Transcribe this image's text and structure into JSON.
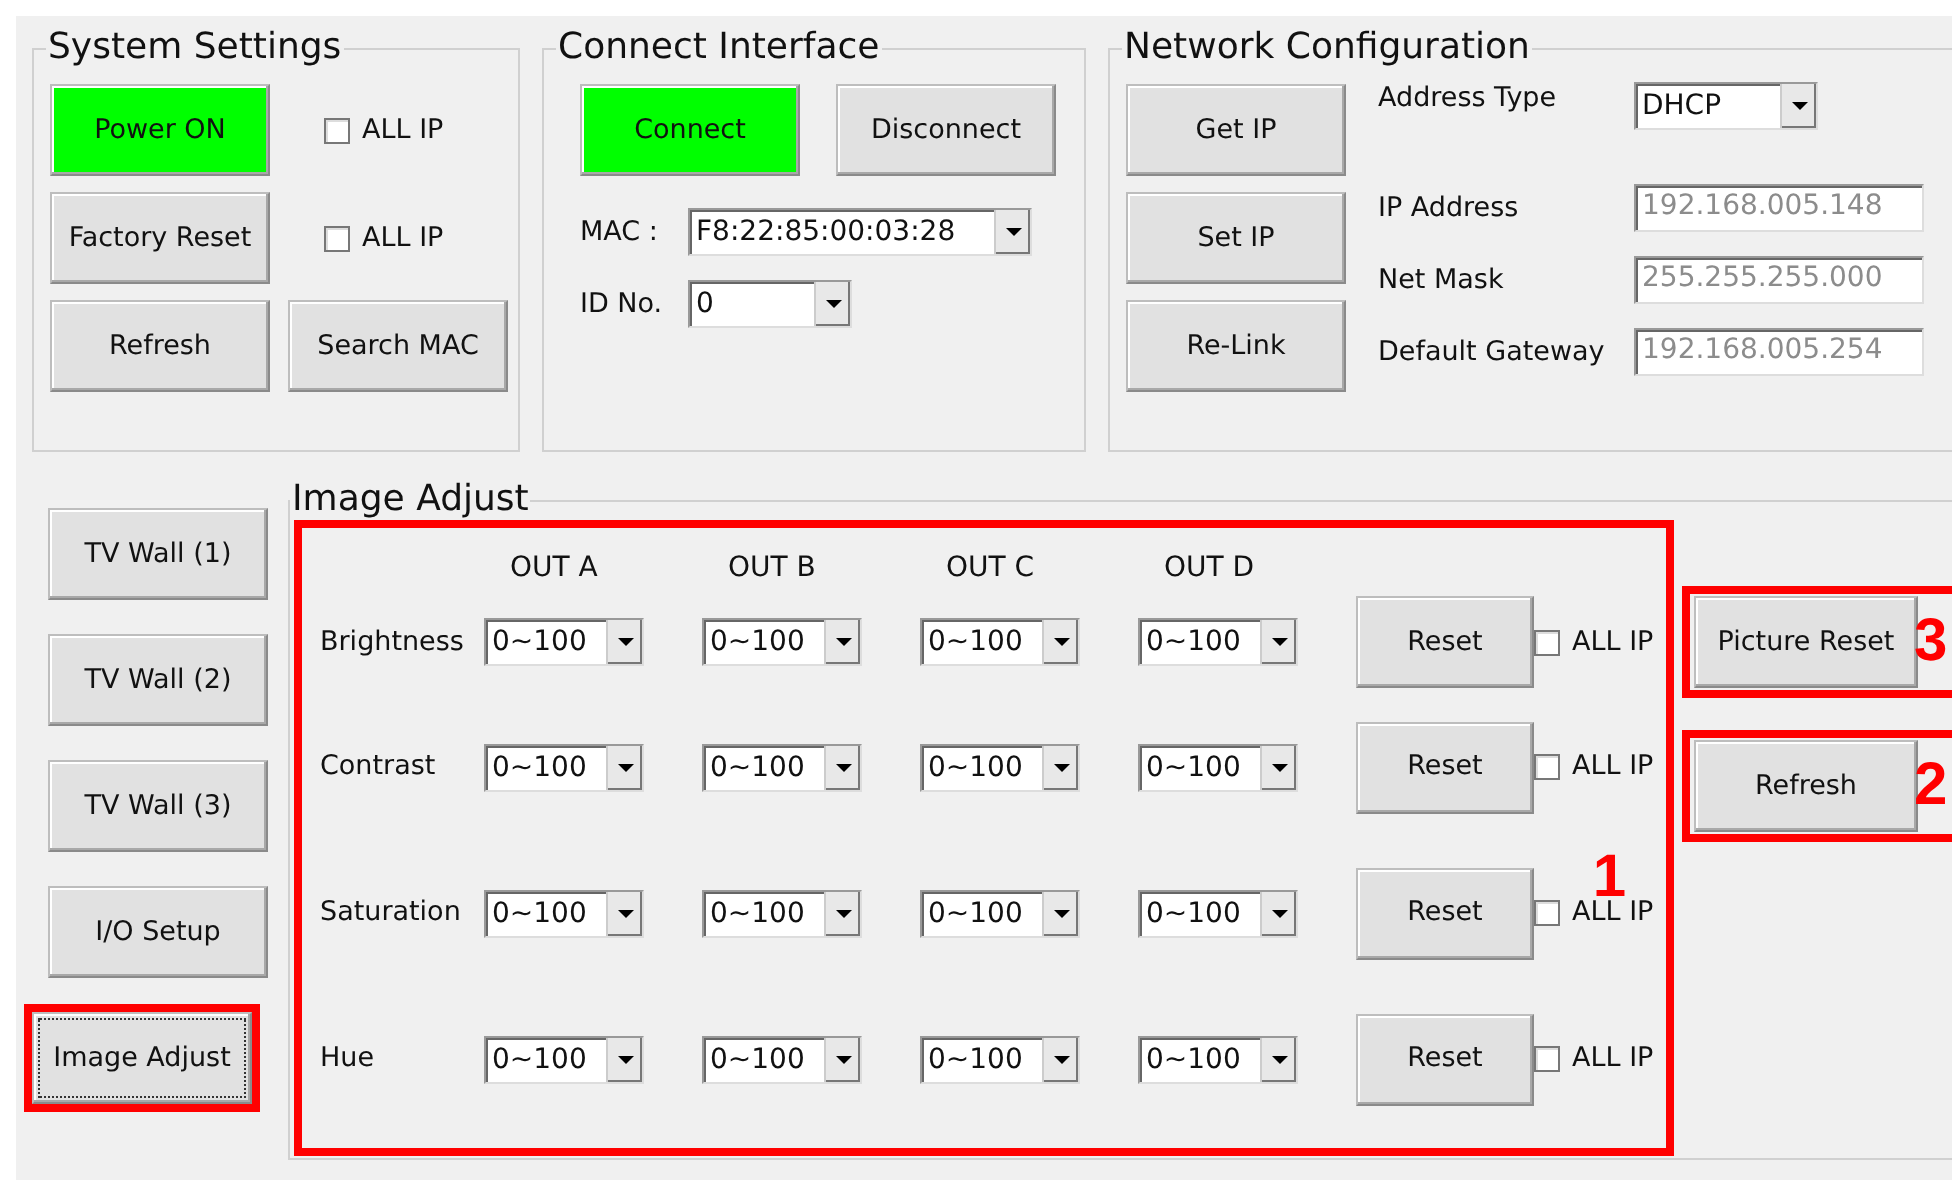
{
  "system_settings": {
    "title": "System Settings",
    "items": [
      {
        "kind": "button",
        "label": "Power ON",
        "active": true
      },
      {
        "kind": "checkbox",
        "label": "ALL IP",
        "checked": false
      },
      {
        "kind": "button",
        "label": "Factory Reset",
        "active": false
      },
      {
        "kind": "checkbox",
        "label": "ALL IP",
        "checked": false
      },
      {
        "kind": "button",
        "label": "Refresh",
        "active": false
      },
      {
        "kind": "button",
        "label": "Search MAC",
        "active": false
      }
    ]
  },
  "connect_interface": {
    "title": "Connect Interface",
    "buttons": [
      {
        "label": "Connect",
        "active": true
      },
      {
        "label": "Disconnect",
        "active": false
      }
    ],
    "fields": [
      {
        "label": "MAC :",
        "value": "F8:22:85:00:03:28"
      },
      {
        "label": "ID No.",
        "value": "0"
      }
    ]
  },
  "network_configuration": {
    "title": "Network Configuration",
    "buttons": [
      "Get IP",
      "Set IP",
      "Re-Link"
    ],
    "address_type": {
      "label": "Address Type",
      "value": "DHCP"
    },
    "fields": [
      {
        "label": "IP Address",
        "value": "192.168.005.148",
        "disabled": true
      },
      {
        "label": "Net Mask",
        "value": "255.255.255.000",
        "disabled": true
      },
      {
        "label": "Default Gateway",
        "value": "192.168.005.254",
        "disabled": true
      }
    ]
  },
  "nav": [
    {
      "label": "TV Wall (1)",
      "selected": false,
      "highlighted": false
    },
    {
      "label": "TV Wall (2)",
      "selected": false,
      "highlighted": false
    },
    {
      "label": "TV Wall (3)",
      "selected": false,
      "highlighted": false
    },
    {
      "label": "I/O Setup",
      "selected": false,
      "highlighted": false
    },
    {
      "label": "Image Adjust",
      "selected": true,
      "highlighted": true
    }
  ],
  "image_adjust": {
    "title": "Image Adjust",
    "annotation": "1",
    "columns": [
      "OUT A",
      "OUT B",
      "OUT C",
      "OUT D"
    ],
    "rows": [
      {
        "label": "Brightness",
        "values": [
          "0~100",
          "0~100",
          "0~100",
          "0~100"
        ],
        "reset": "Reset",
        "checkbox": {
          "label": "ALL IP",
          "checked": false
        }
      },
      {
        "label": "Contrast",
        "values": [
          "0~100",
          "0~100",
          "0~100",
          "0~100"
        ],
        "reset": "Reset",
        "checkbox": {
          "label": "ALL IP",
          "checked": false
        }
      },
      {
        "label": "Saturation",
        "values": [
          "0~100",
          "0~100",
          "0~100",
          "0~100"
        ],
        "reset": "Reset",
        "checkbox": {
          "label": "ALL IP",
          "checked": false
        }
      },
      {
        "label": "Hue",
        "values": [
          "0~100",
          "0~100",
          "0~100",
          "0~100"
        ],
        "reset": "Reset",
        "checkbox": {
          "label": "ALL IP",
          "checked": false
        }
      }
    ]
  },
  "side_buttons": [
    {
      "label": "Picture Reset",
      "annotation": "3"
    },
    {
      "label": "Refresh",
      "annotation": "2"
    }
  ]
}
